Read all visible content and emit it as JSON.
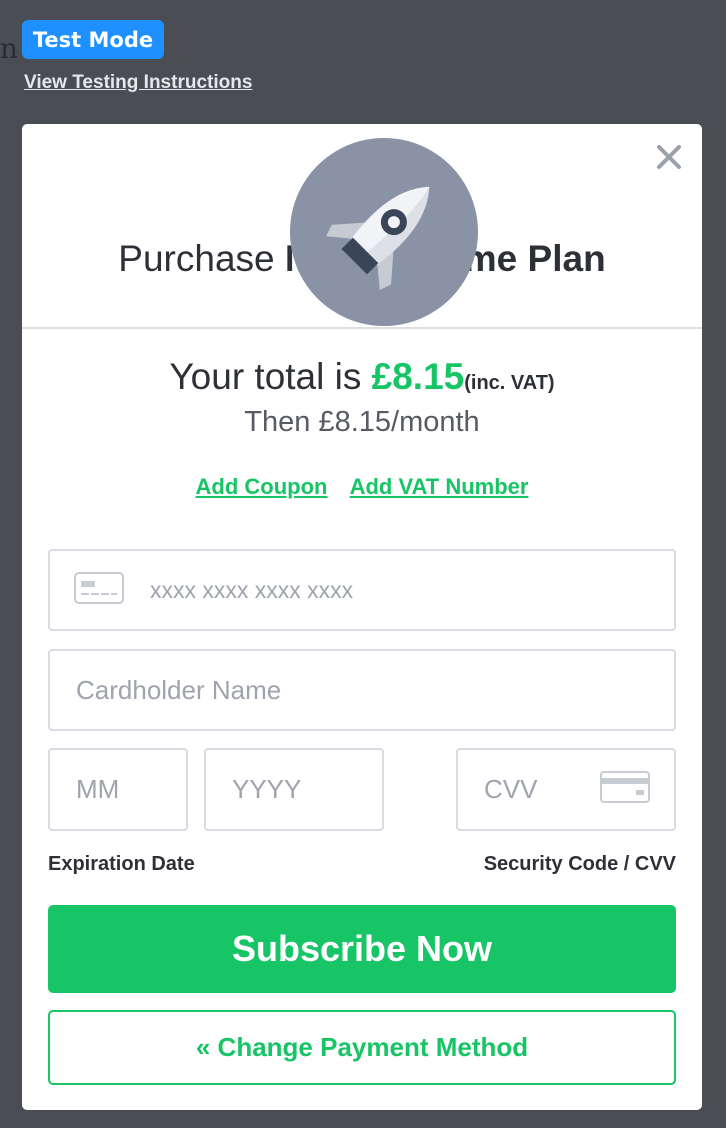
{
  "background": {
    "partial_text": "n below:"
  },
  "badge": {
    "test_mode": "Test Mode"
  },
  "links": {
    "view_testing_instructions": "View Testing Instructions",
    "add_coupon": "Add Coupon",
    "add_vat_number": "Add VAT Number"
  },
  "modal": {
    "logo_icon": "rocket-icon",
    "close_icon": "close-icon",
    "title_prefix": "Purchase",
    "plan_name": "My Awesome Plan",
    "total_prefix": "Your total is",
    "total_amount": "£8.15",
    "total_suffix": "(inc. VAT)",
    "recurring": "Then £8.15/month"
  },
  "form": {
    "card_number_placeholder": "xxxx xxxx xxxx xxxx",
    "cardholder_placeholder": "Cardholder Name",
    "month_placeholder": "MM",
    "year_placeholder": "YYYY",
    "cvv_placeholder": "CVV",
    "expiration_label": "Expiration Date",
    "security_label": "Security Code / CVV"
  },
  "buttons": {
    "subscribe": "Subscribe Now",
    "change_payment": "« Change Payment Method"
  },
  "colors": {
    "accent_green": "#17c566",
    "badge_blue": "#1e90ff",
    "overlay": "#4b4d55",
    "logo_circle": "#8a93a6"
  }
}
